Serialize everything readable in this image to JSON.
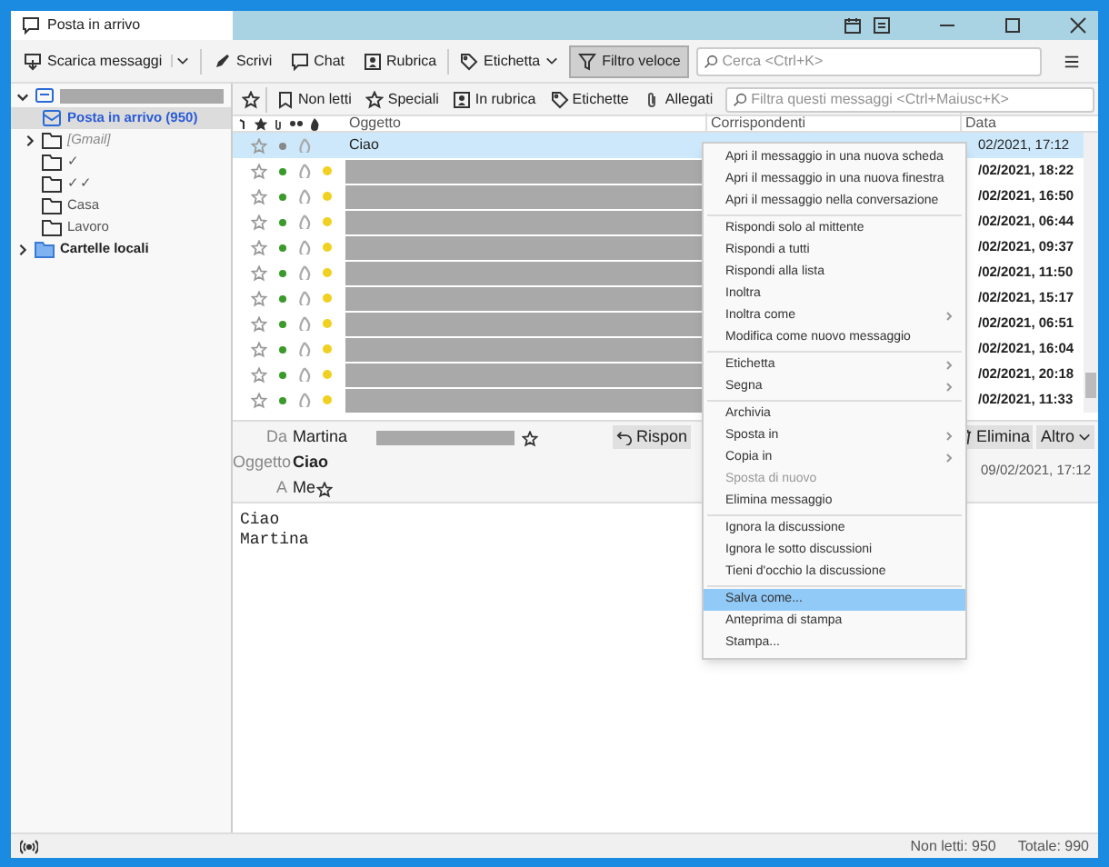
{
  "window": {
    "tab_title": "Posta in arrivo"
  },
  "toolbar": {
    "buttons": [
      {
        "label": "Scarica messaggi",
        "kind": "download",
        "dropdown": true
      },
      {
        "label": "Scrivi",
        "kind": "write",
        "dropdown": false
      },
      {
        "label": "Chat",
        "kind": "chat",
        "dropdown": false
      },
      {
        "label": "Rubrica",
        "kind": "contacts",
        "dropdown": false
      },
      {
        "label": "Etichetta",
        "kind": "tag",
        "dropdown": true
      },
      {
        "label": "Filtro veloce",
        "kind": "filter",
        "dropdown": false,
        "selected": true
      }
    ],
    "search": {
      "placeholder": "Cerca <Ctrl+K>"
    }
  },
  "folders": [
    {
      "kind": "account",
      "redacted": true,
      "expanded": true,
      "selected": false,
      "children": [
        {
          "label": "Posta in arrivo (950)",
          "kind": "inbox",
          "selected": true
        },
        {
          "label": "[Gmail]",
          "kind": "folder",
          "italic": true,
          "expanded": false,
          "selected": false
        },
        {
          "label": "✓",
          "kind": "folder",
          "selected": false
        },
        {
          "label": "✓✓",
          "kind": "folder",
          "selected": false
        },
        {
          "label": "Casa",
          "kind": "folder",
          "selected": false
        },
        {
          "label": "Lavoro",
          "kind": "folder",
          "selected": false
        }
      ]
    },
    {
      "label": "Cartelle locali",
      "kind": "local",
      "expanded": false,
      "selected": false
    }
  ],
  "quick_filter": {
    "buttons": [
      {
        "label": "Non letti",
        "kind": "unread"
      },
      {
        "label": "Speciali",
        "kind": "star"
      },
      {
        "label": "In rubrica",
        "kind": "contacts"
      },
      {
        "label": "Etichette",
        "kind": "tag"
      },
      {
        "label": "Allegati",
        "kind": "attach"
      }
    ],
    "search": {
      "placeholder": "Filtra questi messaggi <Ctrl+Maiusc+K>"
    }
  },
  "message_list": {
    "columns": [
      "Oggetto",
      "Corrispondenti",
      "Data"
    ],
    "rows": [
      {
        "subject": "Ciao",
        "redacted": false,
        "unread": false,
        "selected": true,
        "date": "02/2021, 17:12"
      },
      {
        "subject": "",
        "redacted": true,
        "unread": true,
        "selected": false,
        "date": "/02/2021, 18:22"
      },
      {
        "subject": "",
        "redacted": true,
        "unread": true,
        "selected": false,
        "date": "/02/2021, 16:50"
      },
      {
        "subject": "",
        "redacted": true,
        "unread": true,
        "selected": false,
        "date": "/02/2021, 06:44"
      },
      {
        "subject": "",
        "redacted": true,
        "unread": true,
        "selected": false,
        "date": "/02/2021, 09:37"
      },
      {
        "subject": "",
        "redacted": true,
        "unread": true,
        "selected": false,
        "date": "/02/2021, 11:50"
      },
      {
        "subject": "",
        "redacted": true,
        "unread": true,
        "selected": false,
        "date": "/02/2021, 15:17"
      },
      {
        "subject": "",
        "redacted": true,
        "unread": true,
        "selected": false,
        "date": "/02/2021, 06:51"
      },
      {
        "subject": "",
        "redacted": true,
        "unread": true,
        "selected": false,
        "date": "/02/2021, 16:04"
      },
      {
        "subject": "",
        "redacted": true,
        "unread": true,
        "selected": false,
        "date": "/02/2021, 20:18"
      },
      {
        "subject": "",
        "redacted": true,
        "unread": true,
        "selected": false,
        "date": "/02/2021, 11:33"
      }
    ]
  },
  "preview": {
    "from_label": "Da",
    "from": "Martina",
    "subject_label": "Oggetto",
    "subject": "Ciao",
    "to_label": "A",
    "to": "Me",
    "date": "09/02/2021, 17:12",
    "buttons": [
      {
        "label": "Rispon",
        "kind": "reply"
      },
      {
        "label": "Elimina",
        "kind": "delete"
      },
      {
        "label": "Altro",
        "kind": "more"
      }
    ],
    "body": [
      "Ciao",
      "Martina"
    ]
  },
  "context_menu": [
    {
      "kind": "item",
      "label": "Apri il messaggio in una nuova scheda",
      "disabled": false,
      "selected": false
    },
    {
      "kind": "item",
      "label": "Apri il messaggio in una nuova finestra",
      "disabled": false,
      "selected": false
    },
    {
      "kind": "item",
      "label": "Apri il messaggio nella conversazione",
      "disabled": false,
      "selected": false
    },
    {
      "kind": "separator"
    },
    {
      "kind": "item",
      "label": "Rispondi solo al mittente",
      "disabled": false,
      "selected": false
    },
    {
      "kind": "item",
      "label": "Rispondi a tutti",
      "disabled": false,
      "selected": false
    },
    {
      "kind": "item",
      "label": "Rispondi alla lista",
      "disabled": false,
      "selected": false
    },
    {
      "kind": "item",
      "label": "Inoltra",
      "disabled": false,
      "selected": false
    },
    {
      "kind": "submenu",
      "label": "Inoltra come",
      "disabled": false,
      "selected": false
    },
    {
      "kind": "item",
      "label": "Modifica come nuovo messaggio",
      "disabled": false,
      "selected": false
    },
    {
      "kind": "separator"
    },
    {
      "kind": "submenu",
      "label": "Etichetta",
      "disabled": false,
      "selected": false
    },
    {
      "kind": "submenu",
      "label": "Segna",
      "disabled": false,
      "selected": false
    },
    {
      "kind": "separator"
    },
    {
      "kind": "item",
      "label": "Archivia",
      "disabled": false,
      "selected": false
    },
    {
      "kind": "submenu",
      "label": "Sposta in",
      "disabled": false,
      "selected": false
    },
    {
      "kind": "submenu",
      "label": "Copia in",
      "disabled": false,
      "selected": false
    },
    {
      "kind": "item",
      "label": "Sposta di nuovo",
      "disabled": true,
      "selected": false
    },
    {
      "kind": "item",
      "label": "Elimina messaggio",
      "disabled": false,
      "selected": false
    },
    {
      "kind": "separator"
    },
    {
      "kind": "item",
      "label": "Ignora la discussione",
      "disabled": false,
      "selected": false
    },
    {
      "kind": "item",
      "label": "Ignora le sotto discussioni",
      "disabled": false,
      "selected": false
    },
    {
      "kind": "item",
      "label": "Tieni d'occhio la discussione",
      "disabled": false,
      "selected": false
    },
    {
      "kind": "separator"
    },
    {
      "kind": "item",
      "label": "Salva come...",
      "disabled": false,
      "selected": true
    },
    {
      "kind": "item",
      "label": "Anteprima di stampa",
      "disabled": false,
      "selected": false
    },
    {
      "kind": "item",
      "label": "Stampa...",
      "disabled": false,
      "selected": false
    }
  ],
  "status_bar": {
    "unread": "Non letti: 950",
    "total": "Totale: 990"
  }
}
